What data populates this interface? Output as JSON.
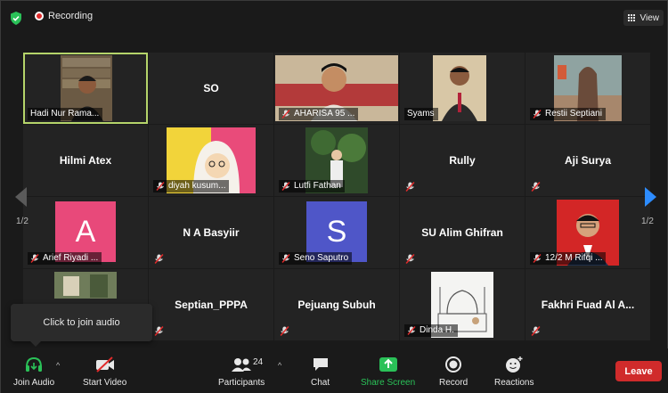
{
  "topbar": {
    "recording_label": "Recording",
    "view_label": "View"
  },
  "nav": {
    "page_left": "1/2",
    "page_right": "1/2"
  },
  "tiles": [
    {
      "name": "Hadi Nur Rama...",
      "muted": false
    },
    {
      "name": "SO",
      "muted": false
    },
    {
      "name": "AHARISA 95 ...",
      "muted": true
    },
    {
      "name": "Syams",
      "muted": false
    },
    {
      "name": "Restii Septiani",
      "muted": true
    },
    {
      "name": "Hilmi Atex",
      "muted": true
    },
    {
      "name": "diyah kusum...",
      "muted": true
    },
    {
      "name": "Lutfi Fathan",
      "muted": true
    },
    {
      "name": "Rully",
      "muted": true
    },
    {
      "name": "Aji Surya",
      "muted": true
    },
    {
      "name": "Arief Riyadi ...",
      "muted": true,
      "avatar_letter": "A",
      "avatar_color": "#e8497a"
    },
    {
      "name": "N A Basyiir",
      "muted": true
    },
    {
      "name": "Seno Saputro",
      "muted": true,
      "avatar_letter": "S",
      "avatar_color": "#4f56c8"
    },
    {
      "name": "SU Alim Ghifran",
      "muted": true
    },
    {
      "name": "12/2 M Rifqi ...",
      "muted": true
    },
    {
      "name": "",
      "muted": true
    },
    {
      "name": "Septian_PPPA",
      "muted": true
    },
    {
      "name": "Pejuang Subuh",
      "muted": true
    },
    {
      "name": "Dinda H.",
      "muted": true
    },
    {
      "name": "Fakhri Fuad Al A...",
      "muted": true
    }
  ],
  "popup": {
    "text": "Click to join audio"
  },
  "toolbar": {
    "join_audio": "Join Audio",
    "start_video": "Start Video",
    "participants": "Participants",
    "participants_count": "24",
    "chat": "Chat",
    "share_screen": "Share Screen",
    "record": "Record",
    "reactions": "Reactions",
    "leave": "Leave"
  },
  "colors": {
    "accent_green": "#2ac158",
    "leave_red": "#d02b2b",
    "speaker_outline": "#b5d46a",
    "nav_blue": "#2d8cff"
  }
}
